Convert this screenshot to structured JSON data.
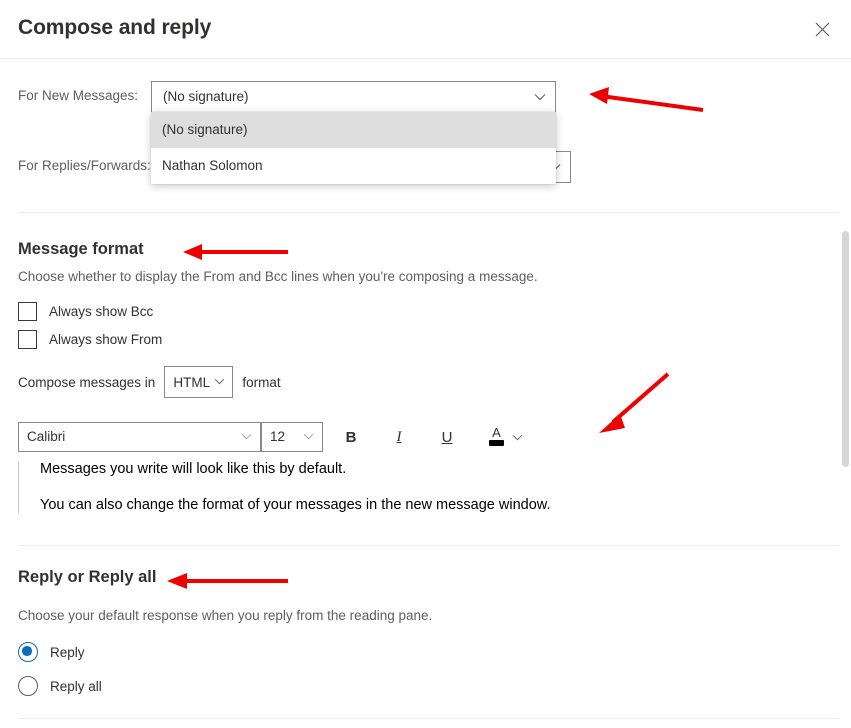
{
  "dialog": {
    "title": "Compose and reply",
    "close_icon": "close-icon"
  },
  "signature": {
    "new_messages": {
      "label": "For New Messages:",
      "value": "(No signature)",
      "chevron_icon": "chevron-down-icon",
      "options": [
        {
          "label": "(No signature)",
          "selected": true
        },
        {
          "label": "Nathan Solomon",
          "selected": false
        }
      ]
    },
    "replies_forwards": {
      "label": "For Replies/Forwards:",
      "value": "",
      "chevron_icon": "chevron-down-icon"
    }
  },
  "message_format": {
    "heading": "Message format",
    "description": "Choose whether to display the From and Bcc lines when you're composing a message.",
    "checkboxes": [
      {
        "label": "Always show Bcc",
        "checked": false
      },
      {
        "label": "Always show From",
        "checked": false
      }
    ],
    "compose_prefix": "Compose messages in",
    "compose_format_value": "HTML",
    "compose_suffix": "format",
    "toolbar": {
      "font_family_value": "Calibri",
      "font_size_value": "12",
      "bold_label": "B",
      "italic_label": "I",
      "underline_label": "U",
      "font_color_label": "A",
      "font_color_swatch": "#000000",
      "chevron_icon": "chevron-down-icon"
    },
    "preview": [
      "Messages you write will look like this by default.",
      "You can also change the format of your messages in the new message window."
    ]
  },
  "reply_section": {
    "heading": "Reply or Reply all",
    "description": "Choose your default response when you reply from the reading pane.",
    "options": [
      {
        "label": "Reply",
        "selected": true
      },
      {
        "label": "Reply all",
        "selected": false
      }
    ]
  },
  "scrollbar": {
    "name": "vertical-scrollbar"
  },
  "annotations": {
    "color": "#ee0000",
    "arrows": [
      {
        "name": "arrow-pointing-to-signature-dropdown",
        "target": "For New Messages dropdown"
      },
      {
        "name": "arrow-pointing-to-message-format-heading",
        "target": "Message format heading"
      },
      {
        "name": "arrow-pointing-to-formatting-toolbar",
        "target": "Font formatting toolbar"
      },
      {
        "name": "arrow-pointing-to-reply-heading",
        "target": "Reply or Reply all heading"
      }
    ]
  },
  "colors": {
    "accent": "#0b6cbe",
    "text_primary": "#323130",
    "text_secondary": "#605e5c",
    "border": "#8a8886",
    "divider": "#edebe9",
    "dropdown_selected_bg": "#dedede",
    "annotation_red": "#ee0000"
  }
}
